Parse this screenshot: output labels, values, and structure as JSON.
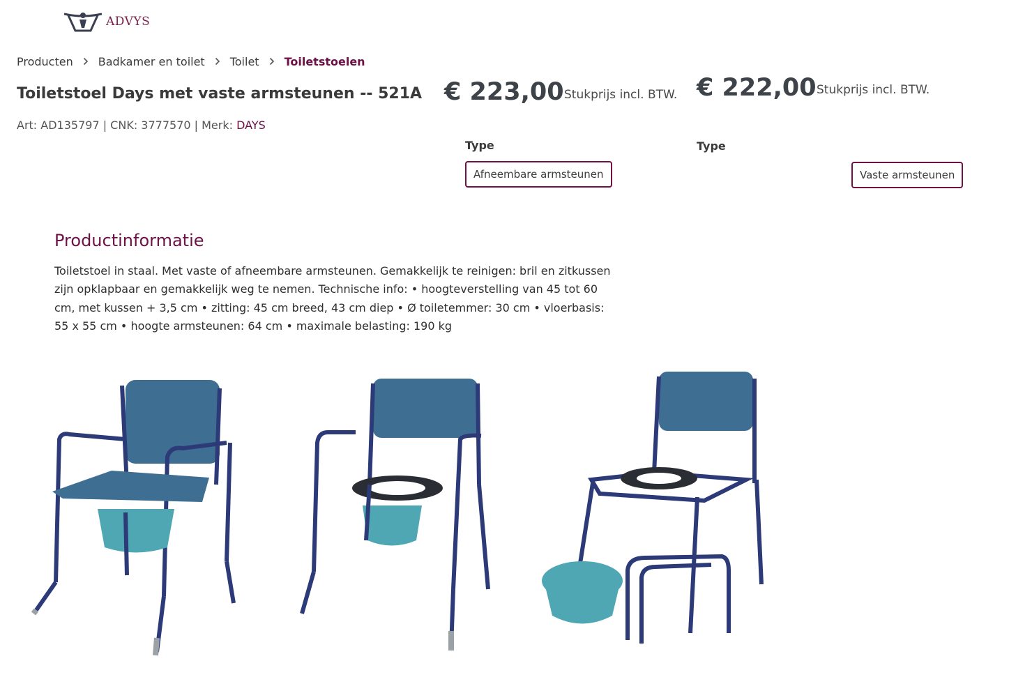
{
  "brand_logo": {
    "text": "ADVYS"
  },
  "breadcrumb": [
    {
      "label": "Producten"
    },
    {
      "label": "Badkamer en toilet"
    },
    {
      "label": "Toilet"
    },
    {
      "label": "Toiletstoelen"
    }
  ],
  "product": {
    "title": "Toiletstoel Days met vaste armsteunen -- 521A",
    "meta_prefix": "Art: AD135797 | CNK: 3777570 | Merk: ",
    "brand": "DAYS"
  },
  "variants": [
    {
      "price": "€ 223,00",
      "price_note": "Stukprijs incl. BTW.",
      "type_label": "Type",
      "option_label": "Afneembare armsteunen"
    },
    {
      "price": "€ 222,00",
      "price_note": "Stukprijs incl. BTW.",
      "type_label": "Type",
      "option_label": "Vaste armsteunen"
    }
  ],
  "info": {
    "heading": "Productinformatie",
    "description": "Toiletstoel in staal. Met vaste of afneembare armsteunen. Gemakkelijk te reinigen: bril en zitkussen zijn opklapbaar en gemakkelijk weg te nemen. Technische info: • hoogteverstelling van 45 tot 60 cm, met kussen + 3,5 cm • zitting: 45 cm breed, 43 cm diep • Ø toiletemmer: 30 cm • vloerbasis: 55 x 55 cm • hoogte armsteunen: 64 cm • maximale belasting: 190 kg"
  },
  "colors": {
    "accent": "#6d1147",
    "frame": "#2d3a78",
    "seat": "#3f6e93",
    "bucket": "#4fa7b3"
  }
}
